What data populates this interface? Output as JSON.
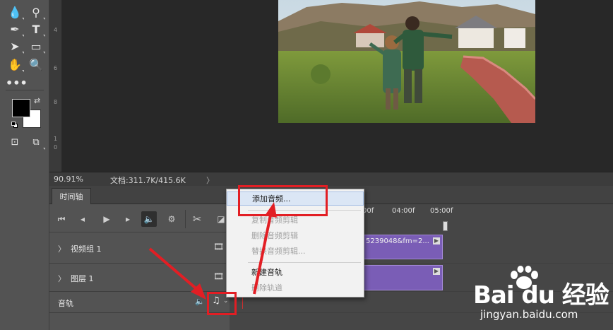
{
  "status_bar": {
    "zoom": "90.91%",
    "doc_info": "文档:311.7K/415.6K",
    "arrow": "〉"
  },
  "ruler": {
    "marks": [
      "4",
      "6",
      "8",
      "1",
      "0"
    ]
  },
  "timeline": {
    "tab_label": "时间轴",
    "time_marks": [
      "00f",
      "04:00f",
      "05:00f"
    ],
    "tracks": [
      {
        "label": "视频组 1",
        "clip_text": "5239048&fm=2..."
      },
      {
        "label": "图层 1",
        "clip_text": ""
      },
      {
        "label": "音轨"
      }
    ]
  },
  "context_menu": {
    "items": [
      {
        "label": "添加音频...",
        "enabled": true
      },
      {
        "label": "复制音频剪辑",
        "enabled": false
      },
      {
        "label": "删除音频剪辑",
        "enabled": false
      },
      {
        "label": "替换音频剪辑...",
        "enabled": false
      },
      {
        "label": "新建音轨",
        "enabled": true
      },
      {
        "label": "删除轨道",
        "enabled": false
      }
    ]
  },
  "watermark": {
    "logo": "Bai du 经验",
    "url": "jingyan.baidu.com"
  },
  "colors": {
    "clip_purple": "#7a5db6",
    "highlight_red": "#e21e24",
    "panel_gray": "#535353"
  }
}
